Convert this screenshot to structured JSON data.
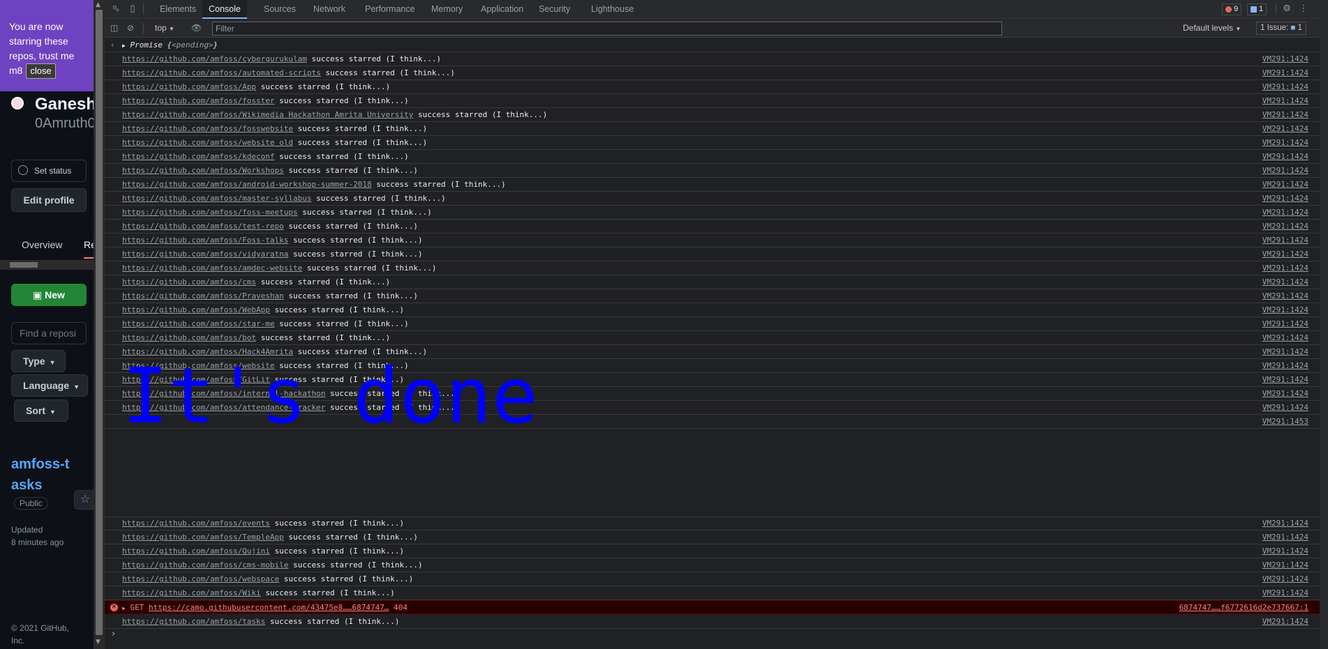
{
  "toast": {
    "message": "You are now starring these repos, trust me m8",
    "close_label": "close"
  },
  "github": {
    "display_name": "Ganesh",
    "username": "0Amruth0",
    "set_status": "Set status",
    "edit_profile": "Edit profile",
    "tabs": [
      {
        "label": "Overview"
      },
      {
        "label": "Re"
      }
    ],
    "new_button": "New",
    "find_placeholder": "Find a reposi",
    "filters": {
      "type": "Type",
      "language": "Language",
      "sort": "Sort"
    },
    "repo": {
      "name": "amfoss-tasks",
      "visibility": "Public",
      "updated_label": "Updated",
      "updated_time": "8 minutes ago"
    },
    "footer": "© 2021 GitHub, Inc."
  },
  "devtools": {
    "tabs": [
      {
        "label": "Elements"
      },
      {
        "label": "Console"
      },
      {
        "label": "Sources"
      },
      {
        "label": "Network"
      },
      {
        "label": "Performance"
      },
      {
        "label": "Memory"
      },
      {
        "label": "Application"
      },
      {
        "label": "Security"
      },
      {
        "label": "Lighthouse"
      }
    ],
    "active_tab": "Console",
    "error_count": "9",
    "message_count": "1",
    "toolbar": {
      "context": "top",
      "filter_placeholder": "Filter",
      "levels": "Default levels",
      "issues": "1 Issue:",
      "issues_count": "1"
    },
    "promise": {
      "prefix": "Promise {",
      "state": "<pending>",
      "suffix": "}"
    },
    "success_text": "success starred (I think...)",
    "source_line": "VM291:1424",
    "done_source": "VM291:1453",
    "done_text": "It's done",
    "log_rows": [
      {
        "url": "https://github.com/amfoss/cybergurukulam"
      },
      {
        "url": "https://github.com/amfoss/automated-scripts"
      },
      {
        "url": "https://github.com/amfoss/App"
      },
      {
        "url": "https://github.com/amfoss/fosster"
      },
      {
        "url": "https://github.com/amfoss/Wikimedia Hackathon Amrita University"
      },
      {
        "url": "https://github.com/amfoss/fosswebsite"
      },
      {
        "url": "https://github.com/amfoss/website old"
      },
      {
        "url": "https://github.com/amfoss/kdeconf"
      },
      {
        "url": "https://github.com/amfoss/Workshops"
      },
      {
        "url": "https://github.com/amfoss/android-workshop-summer-2018"
      },
      {
        "url": "https://github.com/amfoss/master-syllabus"
      },
      {
        "url": "https://github.com/amfoss/foss-meetups"
      },
      {
        "url": "https://github.com/amfoss/test-repo"
      },
      {
        "url": "https://github.com/amfoss/Foss-talks"
      },
      {
        "url": "https://github.com/amfoss/vidyaratna"
      },
      {
        "url": "https://github.com/amfoss/amdec-website"
      },
      {
        "url": "https://github.com/amfoss/cms"
      },
      {
        "url": "https://github.com/amfoss/Praveshan"
      },
      {
        "url": "https://github.com/amfoss/WebApp"
      },
      {
        "url": "https://github.com/amfoss/star-me"
      },
      {
        "url": "https://github.com/amfoss/bot"
      },
      {
        "url": "https://github.com/amfoss/Hack4Amrita"
      },
      {
        "url": "https://github.com/amfoss/website"
      },
      {
        "url": "https://github.com/amfoss/GitLit"
      },
      {
        "url": "https://github.com/amfoss/internal-hackathon"
      },
      {
        "url": "https://github.com/amfoss/attendance-tracker"
      }
    ],
    "log_rows_after": [
      {
        "url": "https://github.com/amfoss/events"
      },
      {
        "url": "https://github.com/amfoss/TempleApp"
      },
      {
        "url": "https://github.com/amfoss/Qujini"
      },
      {
        "url": "https://github.com/amfoss/cms-mobile"
      },
      {
        "url": "https://github.com/amfoss/webspace"
      },
      {
        "url": "https://github.com/amfoss/Wiki"
      }
    ],
    "error_row": {
      "method": "GET",
      "url": "https://camo.githubusercontent.com/43475e8……6874747…",
      "status": "404",
      "source": "6874747……f6772616d2e737667:1"
    },
    "last_row": {
      "url": "https://github.com/amfoss/tasks"
    }
  }
}
